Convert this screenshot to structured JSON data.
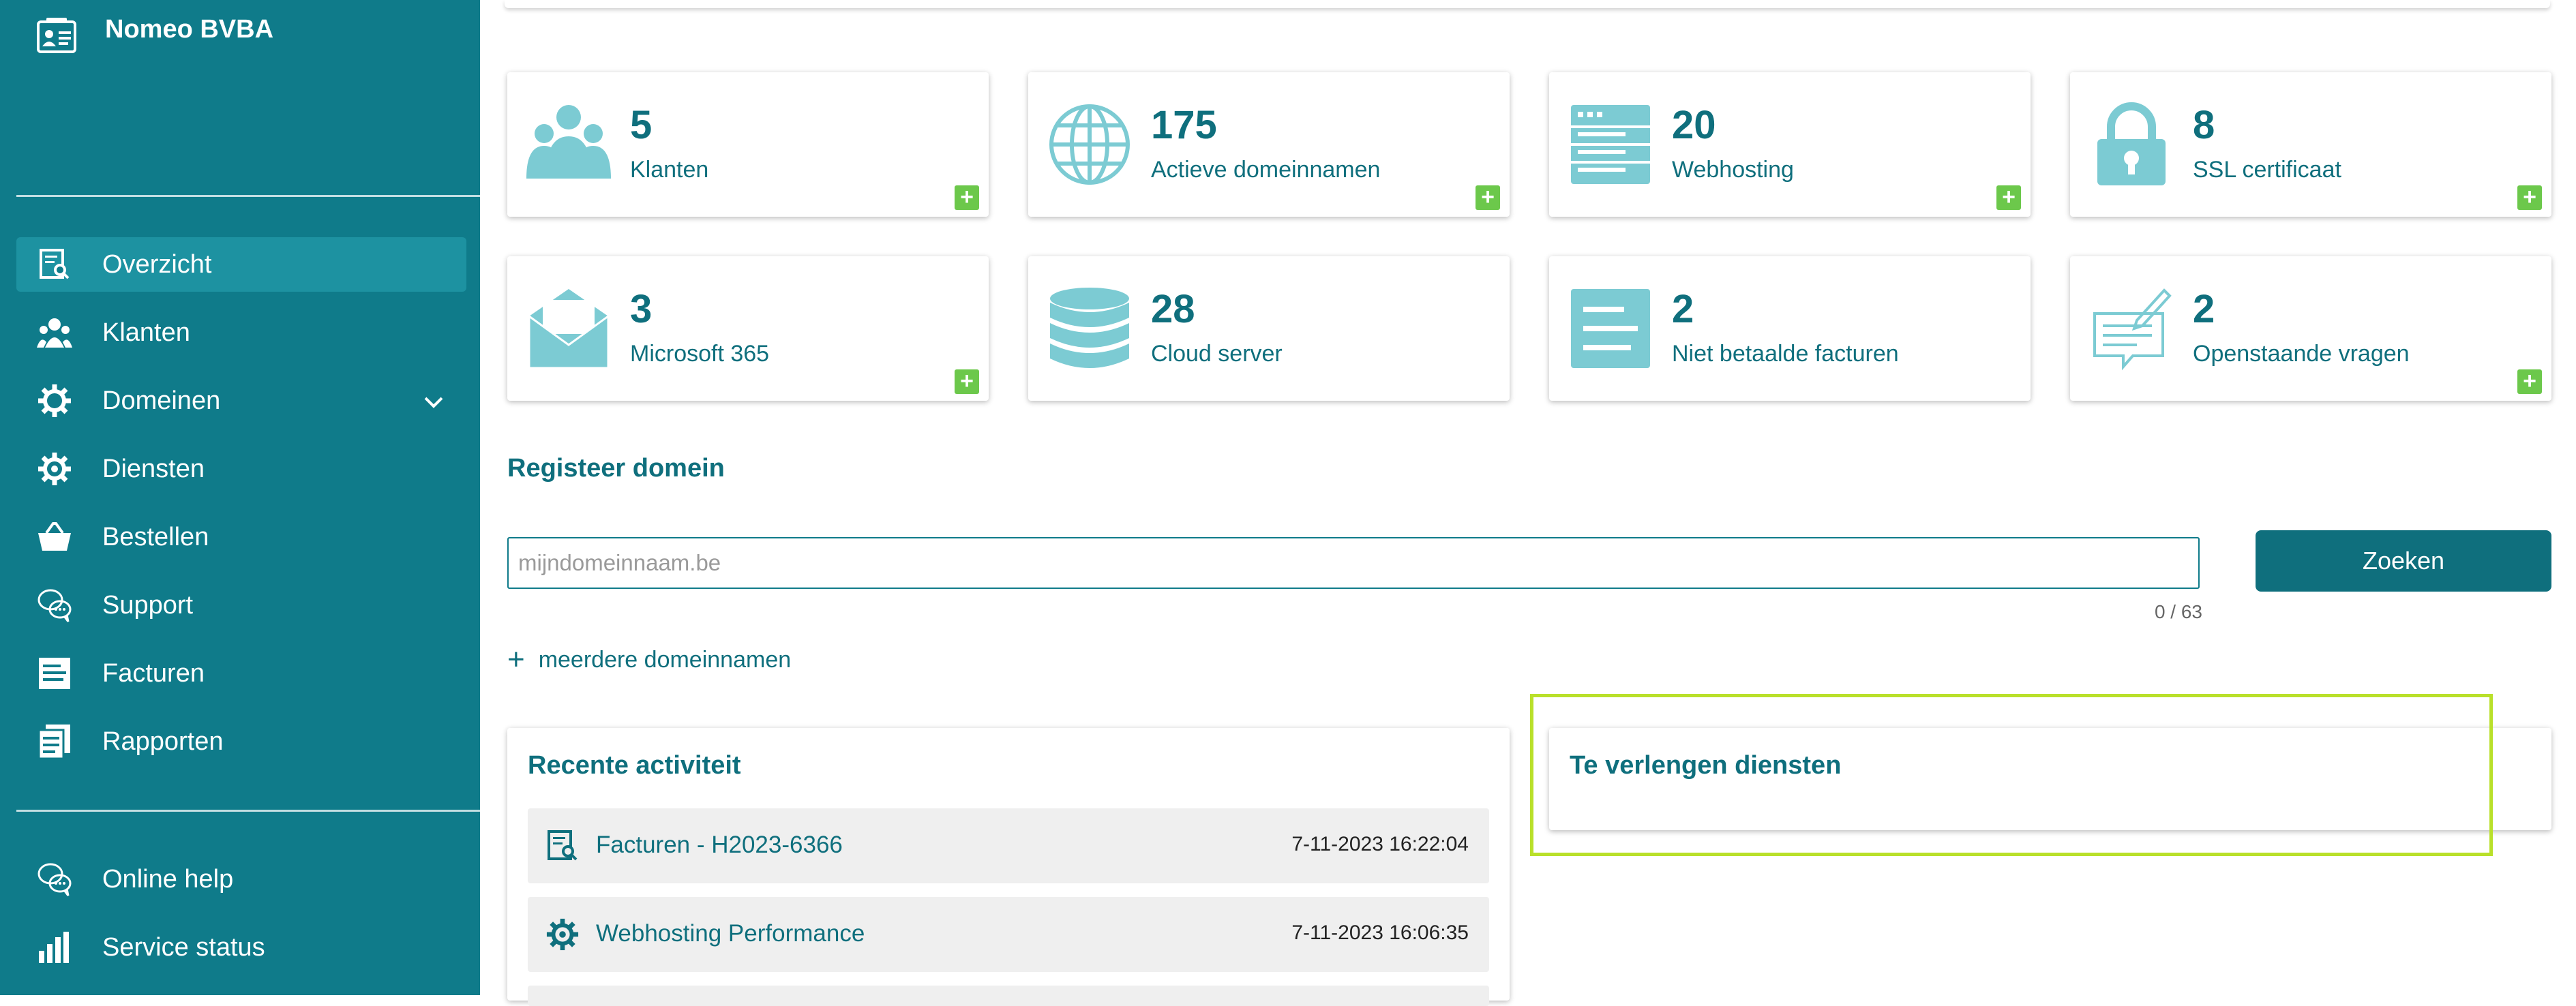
{
  "sidebar": {
    "company": "Nomeo BVBA",
    "items": [
      {
        "label": "Overzicht",
        "icon": "overview-icon"
      },
      {
        "label": "Klanten",
        "icon": "users-icon"
      },
      {
        "label": "Domeinen",
        "icon": "gear-icon"
      },
      {
        "label": "Diensten",
        "icon": "service-gear-icon"
      },
      {
        "label": "Bestellen",
        "icon": "basket-icon"
      },
      {
        "label": "Support",
        "icon": "chat-icon"
      },
      {
        "label": "Facturen",
        "icon": "invoice-icon"
      },
      {
        "label": "Rapporten",
        "icon": "reports-icon"
      }
    ],
    "bottom_items": [
      {
        "label": "Online help",
        "icon": "help-chat-icon"
      },
      {
        "label": "Service status",
        "icon": "bar-chart-icon"
      }
    ]
  },
  "stats": [
    {
      "value": "5",
      "label": "Klanten",
      "icon": "users-icon",
      "has_add": true
    },
    {
      "value": "175",
      "label": "Actieve domeinnamen",
      "icon": "globe-icon",
      "has_add": true
    },
    {
      "value": "20",
      "label": "Webhosting",
      "icon": "server-icon",
      "has_add": true
    },
    {
      "value": "8",
      "label": "SSL certificaat",
      "icon": "lock-icon",
      "has_add": true
    },
    {
      "value": "3",
      "label": "Microsoft 365",
      "icon": "mail-icon",
      "has_add": true
    },
    {
      "value": "28",
      "label": "Cloud server",
      "icon": "database-icon",
      "has_add": false
    },
    {
      "value": "2",
      "label": "Niet betaalde facturen",
      "icon": "invoice-icon",
      "has_add": false
    },
    {
      "value": "2",
      "label": "Openstaande vragen",
      "icon": "question-note-icon",
      "has_add": true
    }
  ],
  "register": {
    "title": "Registeer domein",
    "placeholder": "mijndomeinnaam.be",
    "value": "",
    "counter": "0 / 63",
    "search_label": "Zoeken",
    "more_label": "meerdere domeinnamen"
  },
  "activity": {
    "title": "Recente activiteit",
    "rows": [
      {
        "title": "Facturen - H2023-6366",
        "time": "7-11-2023 16:22:04",
        "icon": "invoice-search-icon"
      },
      {
        "title": "Webhosting Performance",
        "time": "7-11-2023 16:06:35",
        "icon": "service-gear-icon"
      }
    ]
  },
  "renewals": {
    "title": "Te verlengen diensten"
  },
  "colors": {
    "sidebar": "#0f7b8a",
    "active_item": "#1d92a1",
    "primary_text": "#0f6f7d",
    "icon_light": "#7ccbd3",
    "add_green": "#6cc84b",
    "highlight": "#b9e02a"
  }
}
